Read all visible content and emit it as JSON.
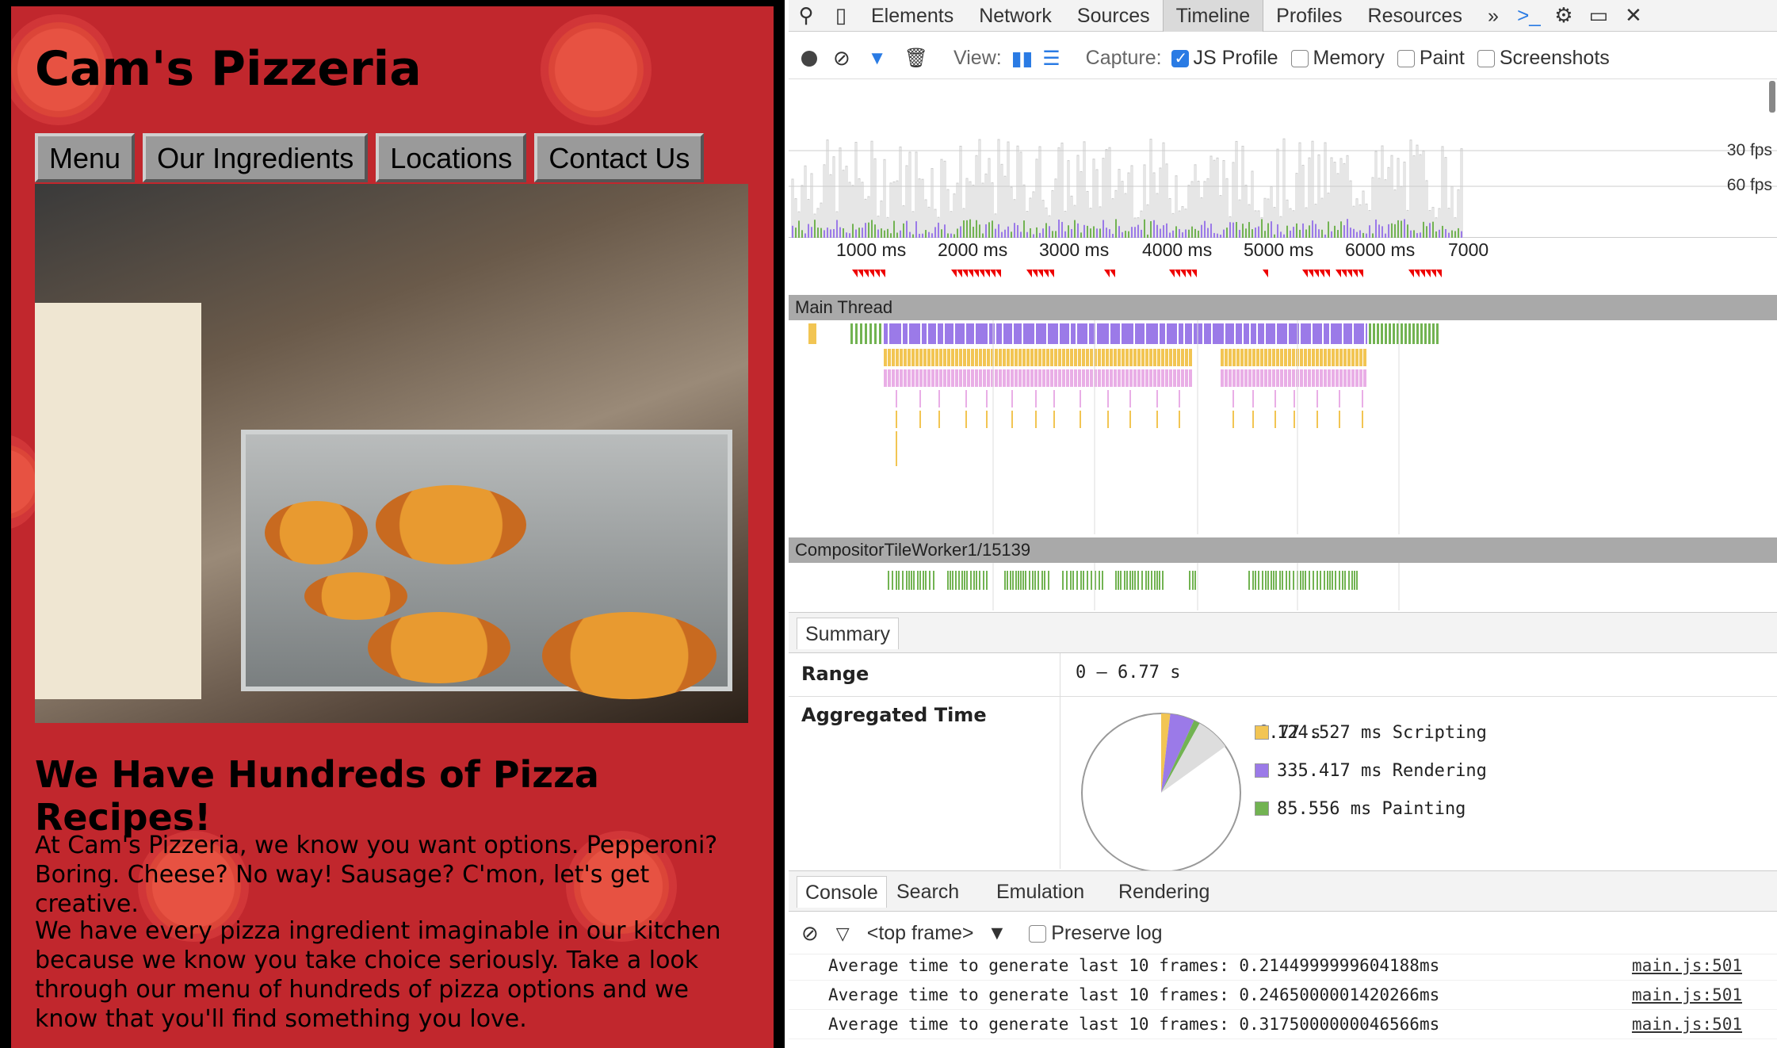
{
  "site": {
    "title": "Cam's Pizzeria",
    "nav": [
      "Menu",
      "Our Ingredients",
      "Locations",
      "Contact Us"
    ],
    "headline": "We Have Hundreds of Pizza Recipes!",
    "para1": "At Cam's Pizzeria, we know you want options. Pepperoni? Boring. Cheese? No way! Sausage? C'mon, let's get creative.",
    "para2": "We have every pizza ingredient imaginable in our kitchen because we know you take choice seriously. Take a look through our menu of hundreds of pizza options and we know that you'll find something you love.",
    "colors": {
      "background": "#c1272d",
      "nav_button": "#9a9a9a"
    }
  },
  "devtools": {
    "tabs": [
      "Elements",
      "Network",
      "Sources",
      "Timeline",
      "Profiles",
      "Resources"
    ],
    "active_tab": "Timeline",
    "more": "»",
    "toolbar_icons": [
      "search-icon",
      "device-icon",
      "console-icon",
      "gear-icon",
      "dock-icon",
      "close-icon"
    ],
    "capture": {
      "view_label": "View:",
      "capture_label": "Capture:",
      "options": [
        {
          "label": "JS Profile",
          "checked": true
        },
        {
          "label": "Memory",
          "checked": false
        },
        {
          "label": "Paint",
          "checked": false
        },
        {
          "label": "Screenshots",
          "checked": false
        }
      ]
    },
    "fps_labels": [
      "30 fps",
      "60 fps"
    ],
    "ruler": [
      "1000 ms",
      "2000 ms",
      "3000 ms",
      "4000 ms",
      "5000 ms",
      "6000 ms",
      "7000"
    ],
    "threads": {
      "main": "Main Thread",
      "compositor": "CompositorTileWorker1/15139"
    },
    "summary": {
      "tab": "Summary",
      "range_label": "Range",
      "range_value": "0 – 6.77 s",
      "aggregated_label": "Aggregated Time",
      "total": "6.77 s",
      "items": [
        {
          "value": "124.527 ms",
          "label": "Scripting",
          "color": "#f2c553"
        },
        {
          "value": "335.417 ms",
          "label": "Rendering",
          "color": "#9b7ae8"
        },
        {
          "value": "85.556 ms",
          "label": "Painting",
          "color": "#72b352"
        }
      ]
    },
    "drawer_tabs": [
      "Console",
      "Search",
      "Emulation",
      "Rendering"
    ],
    "console": {
      "frame": "<top frame>",
      "preserve_log": "Preserve log",
      "lines": [
        {
          "text": "Average time to generate last 10 frames: 0.2144999999604188ms",
          "src": "main.js:501"
        },
        {
          "text": "Average time to generate last 10 frames: 0.2465000001420266ms",
          "src": "main.js:501"
        },
        {
          "text": "Average time to generate last 10 frames: 0.3175000000046566ms",
          "src": "main.js:501"
        }
      ]
    }
  }
}
